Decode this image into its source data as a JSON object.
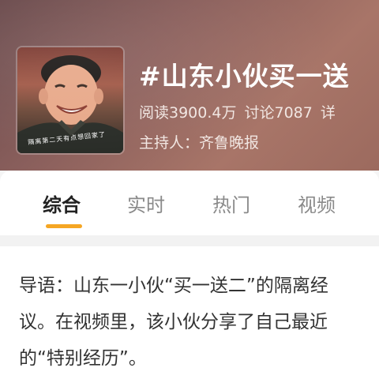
{
  "topic": {
    "title": "#山东小伙买一送",
    "reads": "阅读3900.4万",
    "discussions": "讨论7087",
    "more_cut": "详",
    "host": "主持人：齐鲁晚报",
    "avatar_caption": "隔离第二天有点想回家了"
  },
  "tabs": [
    {
      "label": "综合"
    },
    {
      "label": "实时"
    },
    {
      "label": "热门"
    },
    {
      "label": "视频"
    }
  ],
  "article": {
    "lines": [
      "导语：山东一小伙“买一送二”的隔离经",
      "议。在视频里，该小伙分享了自己最近",
      "的“特别经历”。"
    ]
  },
  "colors": {
    "accent": "#f5a623",
    "header_bg": "#8a5f5c",
    "active_tab": "#222222",
    "inactive_tab": "#8a8a8a"
  }
}
